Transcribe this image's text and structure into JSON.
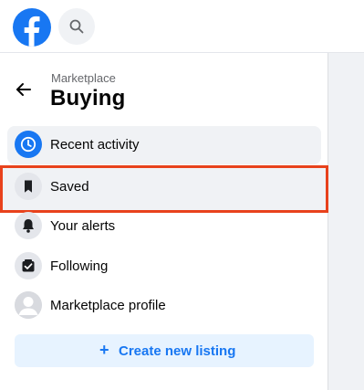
{
  "header": {
    "logo_icon": "facebook-logo-icon",
    "search_icon": "search-icon"
  },
  "sidebar": {
    "breadcrumb": "Marketplace",
    "title": "Buying",
    "back_icon": "arrow-left-icon",
    "items": [
      {
        "label": "Recent activity",
        "icon": "clock-icon",
        "active": true
      },
      {
        "label": "Saved",
        "icon": "bookmark-icon",
        "highlighted": true
      },
      {
        "label": "Your alerts",
        "icon": "bell-icon"
      },
      {
        "label": "Following",
        "icon": "following-check-icon"
      },
      {
        "label": "Marketplace profile",
        "icon": "avatar-icon"
      }
    ],
    "create_button": {
      "label": "Create new listing",
      "icon": "plus-icon"
    }
  },
  "colors": {
    "brand_blue": "#1877f2",
    "highlight_border": "#e8421c",
    "create_button_bg": "#e7f3ff"
  }
}
